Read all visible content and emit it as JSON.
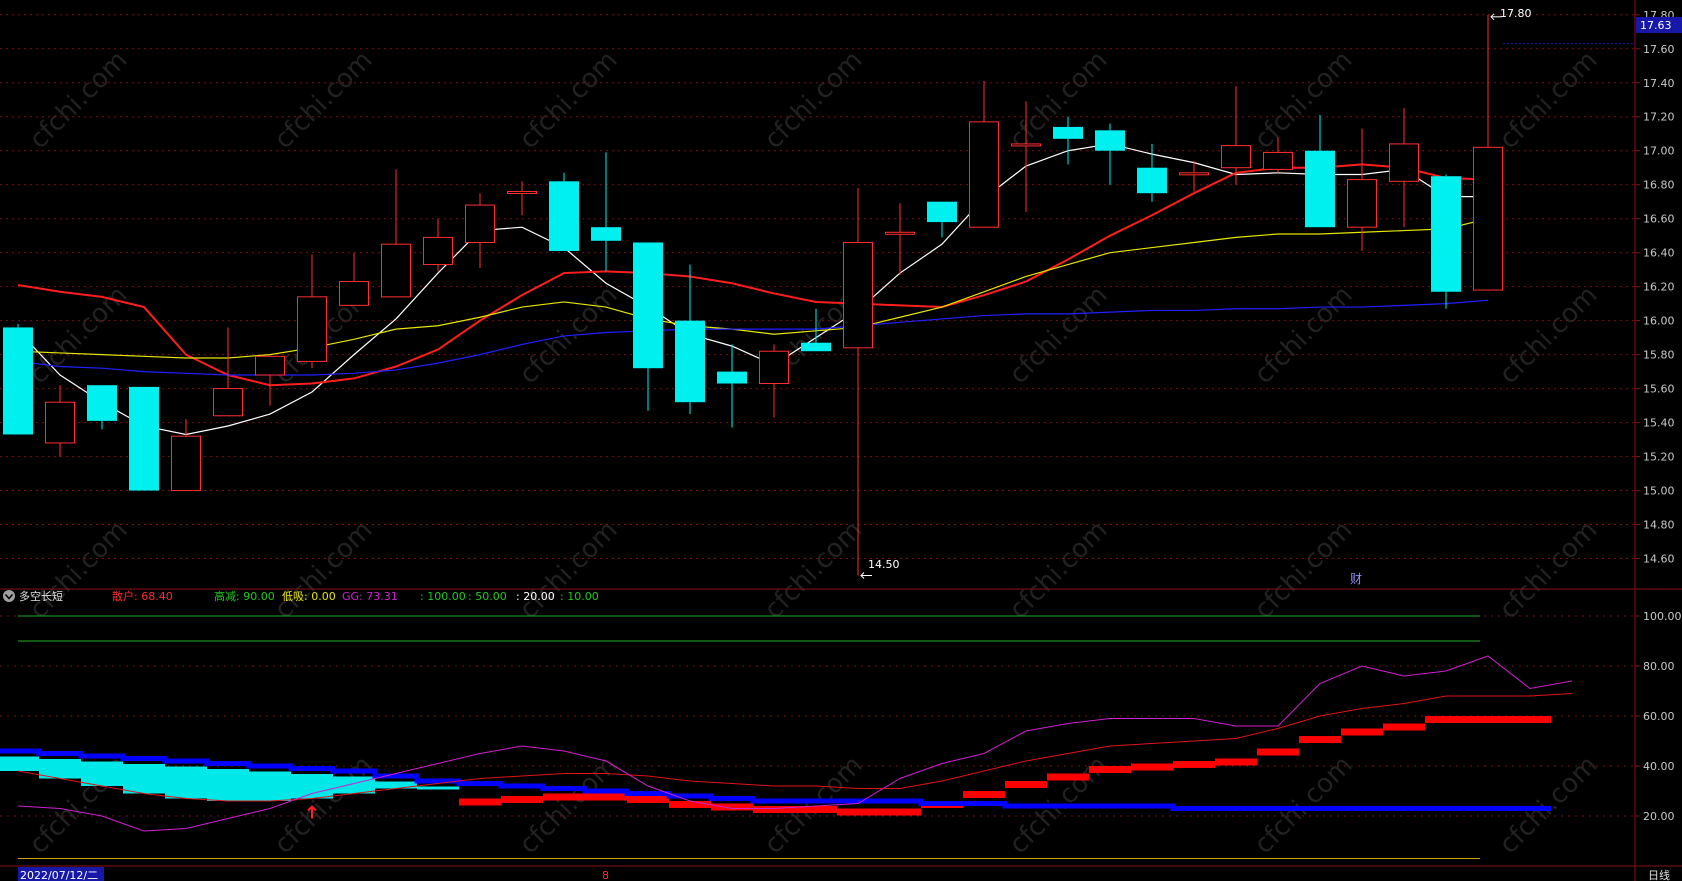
{
  "chart_data": {
    "type": "candlestick",
    "main": {
      "y_ticks": [
        "17.80",
        "17.60",
        "17.40",
        "17.20",
        "17.00",
        "16.80",
        "16.60",
        "16.40",
        "16.20",
        "16.00",
        "15.80",
        "15.60",
        "15.40",
        "15.20",
        "15.00",
        "14.80",
        "14.60"
      ],
      "ylim": [
        14.45,
        17.84
      ],
      "current_price": "17.63",
      "high_label": "17.80",
      "low_label": "14.50",
      "event_marker": "财",
      "candles": [
        {
          "o": 15.96,
          "h": 15.98,
          "l": 15.33,
          "c": 15.33
        },
        {
          "o": 15.28,
          "h": 15.62,
          "l": 15.2,
          "c": 15.52
        },
        {
          "o": 15.62,
          "h": 15.62,
          "l": 15.36,
          "c": 15.41
        },
        {
          "o": 15.61,
          "h": 15.61,
          "l": 15.0,
          "c": 15.0
        },
        {
          "o": 15.0,
          "h": 15.42,
          "l": 15.0,
          "c": 15.32
        },
        {
          "o": 15.44,
          "h": 15.96,
          "l": 15.44,
          "c": 15.6
        },
        {
          "o": 15.68,
          "h": 15.76,
          "l": 15.5,
          "c": 15.79
        },
        {
          "o": 15.76,
          "h": 16.39,
          "l": 15.72,
          "c": 16.14
        },
        {
          "o": 16.09,
          "h": 16.4,
          "l": 16.09,
          "c": 16.23
        },
        {
          "o": 16.14,
          "h": 16.89,
          "l": 16.14,
          "c": 16.45
        },
        {
          "o": 16.33,
          "h": 16.6,
          "l": 16.29,
          "c": 16.49
        },
        {
          "o": 16.46,
          "h": 16.75,
          "l": 16.31,
          "c": 16.68
        },
        {
          "o": 16.76,
          "h": 16.82,
          "l": 16.62,
          "c": 16.76
        },
        {
          "o": 16.82,
          "h": 16.87,
          "l": 16.41,
          "c": 16.41
        },
        {
          "o": 16.55,
          "h": 16.99,
          "l": 16.29,
          "c": 16.47
        },
        {
          "o": 16.46,
          "h": 16.46,
          "l": 15.47,
          "c": 15.72
        },
        {
          "o": 16.0,
          "h": 16.33,
          "l": 15.45,
          "c": 15.52
        },
        {
          "o": 15.7,
          "h": 15.86,
          "l": 15.37,
          "c": 15.63
        },
        {
          "o": 15.63,
          "h": 15.86,
          "l": 15.43,
          "c": 15.82
        },
        {
          "o": 15.87,
          "h": 16.07,
          "l": 15.82,
          "c": 15.82
        },
        {
          "o": 15.84,
          "h": 16.78,
          "l": 14.5,
          "c": 16.46
        },
        {
          "o": 16.52,
          "h": 16.69,
          "l": 16.27,
          "c": 16.52
        },
        {
          "o": 16.7,
          "h": 16.7,
          "l": 16.49,
          "c": 16.58
        },
        {
          "o": 16.55,
          "h": 17.41,
          "l": 16.55,
          "c": 17.17
        },
        {
          "o": 17.04,
          "h": 17.29,
          "l": 16.64,
          "c": 17.04
        },
        {
          "o": 17.14,
          "h": 17.2,
          "l": 16.92,
          "c": 17.07
        },
        {
          "o": 17.12,
          "h": 17.16,
          "l": 16.8,
          "c": 17.0
        },
        {
          "o": 16.9,
          "h": 17.04,
          "l": 16.7,
          "c": 16.75
        },
        {
          "o": 16.87,
          "h": 16.94,
          "l": 16.76,
          "c": 16.87
        },
        {
          "o": 16.9,
          "h": 17.38,
          "l": 16.8,
          "c": 17.03
        },
        {
          "o": 16.89,
          "h": 17.08,
          "l": 16.87,
          "c": 16.99
        },
        {
          "o": 17.0,
          "h": 17.21,
          "l": 16.55,
          "c": 16.55
        },
        {
          "o": 16.55,
          "h": 17.13,
          "l": 16.41,
          "c": 16.83
        },
        {
          "o": 16.82,
          "h": 17.25,
          "l": 16.55,
          "c": 17.04
        },
        {
          "o": 16.85,
          "h": 16.86,
          "l": 16.07,
          "c": 16.17
        },
        {
          "o": 16.18,
          "h": 17.8,
          "l": 16.18,
          "c": 17.02
        }
      ],
      "ma_lines": [
        {
          "color": "#ffffff",
          "values": [
            15.94,
            15.68,
            15.52,
            15.38,
            15.33,
            15.38,
            15.45,
            15.58,
            15.8,
            16.01,
            16.28,
            16.53,
            16.55,
            16.43,
            16.22,
            16.08,
            15.92,
            15.85,
            15.74,
            15.9,
            16.06,
            16.28,
            16.45,
            16.72,
            16.91,
            17.0,
            17.04,
            16.98,
            16.93,
            16.86,
            16.87,
            16.86,
            16.86,
            16.89,
            16.73,
            16.73
          ]
        },
        {
          "color": "#ff1e1e",
          "values": [
            16.21,
            16.17,
            16.14,
            16.08,
            15.8,
            15.68,
            15.62,
            15.63,
            15.66,
            15.73,
            15.83,
            16.0,
            16.15,
            16.28,
            16.29,
            16.28,
            16.26,
            16.22,
            16.16,
            16.11,
            16.1,
            16.09,
            16.08,
            16.15,
            16.23,
            16.36,
            16.5,
            16.62,
            16.75,
            16.87,
            16.9,
            16.9,
            16.92,
            16.9,
            16.84,
            16.83
          ]
        },
        {
          "color": "#e6e600",
          "values": [
            15.82,
            15.81,
            15.8,
            15.79,
            15.78,
            15.78,
            15.8,
            15.84,
            15.89,
            15.95,
            15.97,
            16.02,
            16.08,
            16.11,
            16.08,
            16.01,
            15.97,
            15.95,
            15.92,
            15.94,
            15.96,
            16.02,
            16.08,
            16.17,
            16.26,
            16.33,
            16.4,
            16.43,
            16.46,
            16.49,
            16.51,
            16.51,
            16.52,
            16.53,
            16.54,
            16.6
          ]
        },
        {
          "color": "#2020ff",
          "values": [
            15.76,
            15.73,
            15.72,
            15.7,
            15.69,
            15.68,
            15.68,
            15.68,
            15.69,
            15.71,
            15.75,
            15.8,
            15.86,
            15.91,
            15.93,
            15.94,
            15.95,
            15.95,
            15.95,
            15.95,
            15.97,
            15.99,
            16.01,
            16.03,
            16.04,
            16.04,
            16.05,
            16.06,
            16.06,
            16.07,
            16.07,
            16.08,
            16.08,
            16.09,
            16.1,
            16.12
          ]
        }
      ]
    },
    "indicator": {
      "name": "多空长短",
      "legend": [
        {
          "label": "散户: 68.40",
          "color": "#ff2a2a"
        },
        {
          "label": "高减: 90.00",
          "color": "#22c722"
        },
        {
          "label": "低吸: 0.00",
          "color": "#e6e600"
        },
        {
          "label": "GG: 73.31",
          "color": "#d020d0"
        },
        {
          "label": ": 100.00",
          "color": "#22c722"
        },
        {
          "label": ": 50.00",
          "color": "#22c722"
        },
        {
          "label": ": 20.00",
          "color": "#ffffff"
        },
        {
          "label": ": 10.00",
          "color": "#22c722"
        }
      ],
      "y_ticks": [
        "100.00",
        "80.00",
        "60.00",
        "40.00",
        "20.00"
      ],
      "ylim": [
        0,
        106
      ],
      "levels": [
        {
          "y": 100,
          "color": "#1fae1f"
        },
        {
          "y": 90,
          "color": "#1fae1f"
        },
        {
          "y": 3,
          "color": "#c8a800"
        }
      ],
      "gg": [
        24,
        23,
        20,
        14,
        15,
        19,
        23,
        29,
        33,
        37,
        41,
        45,
        48,
        46,
        42,
        32,
        26,
        23,
        23,
        24,
        25,
        35,
        41,
        45,
        54,
        57,
        59,
        59,
        59,
        56,
        56,
        73,
        80,
        76,
        78,
        84,
        71,
        74
      ],
      "sanhu": [
        38,
        35,
        32,
        29,
        27,
        26,
        26,
        27,
        29,
        31,
        33,
        35,
        36,
        37,
        37,
        36,
        34,
        33,
        32,
        32,
        31,
        31,
        34,
        38,
        42,
        45,
        48,
        49,
        50,
        51,
        55,
        60,
        63,
        65,
        68,
        68,
        68,
        69
      ],
      "blue": [
        46,
        45,
        44,
        43,
        42,
        41,
        40,
        39,
        38,
        36,
        34,
        33,
        32,
        31,
        30,
        29,
        28,
        27,
        26,
        26,
        26,
        26,
        25,
        25,
        24,
        24,
        24,
        24,
        23,
        23,
        23,
        23,
        23,
        23,
        23,
        23,
        23
      ],
      "arrow_index": 7,
      "date": "2022/07/12/二",
      "marker": "8",
      "period": "日线"
    }
  }
}
